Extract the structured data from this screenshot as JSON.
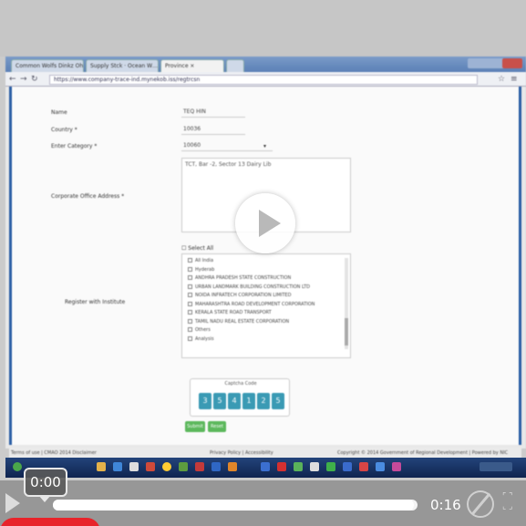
{
  "browser": {
    "tabs": [
      "Common Wolfs Dinkz Oh… ×",
      "Supply Stck · Ocean W… ×",
      "Province ×",
      ""
    ],
    "url": "https://www.company-trace-ind.mynekob.iss/regtrcsn"
  },
  "form": {
    "fields": [
      {
        "label": "Name",
        "value": "TEQ HIN"
      },
      {
        "label": "Country *",
        "value": "10036"
      },
      {
        "label": "Enter Category *",
        "value": "10060"
      }
    ],
    "address_label": "Corporate Office Address *",
    "address_value": "TCT, Bar -2,  Sector 13 Dairy Lib",
    "register_label": "Register with Institute",
    "select_all": "Select All",
    "options": [
      "All India",
      "Hyderab",
      "ANDHRA PRADESH STATE CONSTRUCTION",
      "URBAN LANDMARK BUILDING CONSTRUCTION LTD",
      "NOIDA INFRATECH CORPORATION LIMITED",
      "MAHARASHTRA ROAD DEVELOPMENT CORPORATION",
      "KERALA STATE ROAD TRANSPORT",
      "TAMIL NADU REAL ESTATE CORPORATION",
      "Others",
      "Analysis"
    ],
    "captcha_title": "Captcha Code",
    "captcha_digits": [
      "3",
      "5",
      "4",
      "1",
      "2",
      "5"
    ],
    "submit_label": "Submit",
    "reset_label": "Reset"
  },
  "footer": {
    "left": "Terms of use | CMAO 2014 Disclaimer",
    "center": "Privacy Policy | Accessibility",
    "right": "Copyright © 2014 Government of Regional Development | Powered by NIC"
  },
  "player": {
    "current_time": "0:00",
    "duration": "0:16",
    "progress_fraction": 0.99
  },
  "colors": {
    "page_border": "#2a5ea5",
    "captcha_digit": "#3a9ab4",
    "button_green": "#5cb85c",
    "logo_red": "#e8232a"
  }
}
